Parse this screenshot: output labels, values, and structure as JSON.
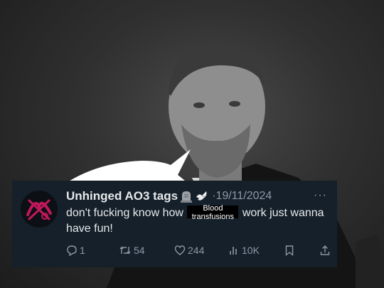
{
  "tweet": {
    "display_name": "Unhinged AO3 tags",
    "date": "·19/11/2024",
    "more_label": "···",
    "text_before": "don't fucking know how",
    "redacted_label_line1": "Blood",
    "redacted_label_line2": "transfusions",
    "text_after": "work just wanna have fun!"
  },
  "actions": {
    "replies": "1",
    "reposts": "54",
    "likes": "244",
    "views": "10K"
  },
  "icons": {
    "emoji_1": "headstone-icon",
    "emoji_2": "dove-icon",
    "reply": "reply-icon",
    "repost": "repost-icon",
    "like": "heart-icon",
    "views": "views-icon",
    "bookmark": "bookmark-icon",
    "share": "share-icon"
  },
  "colors": {
    "card_background": "#15202b",
    "text_primary": "#e7e9ea",
    "text_secondary": "#8b98a5",
    "avatar_accent": "#c2185b"
  }
}
